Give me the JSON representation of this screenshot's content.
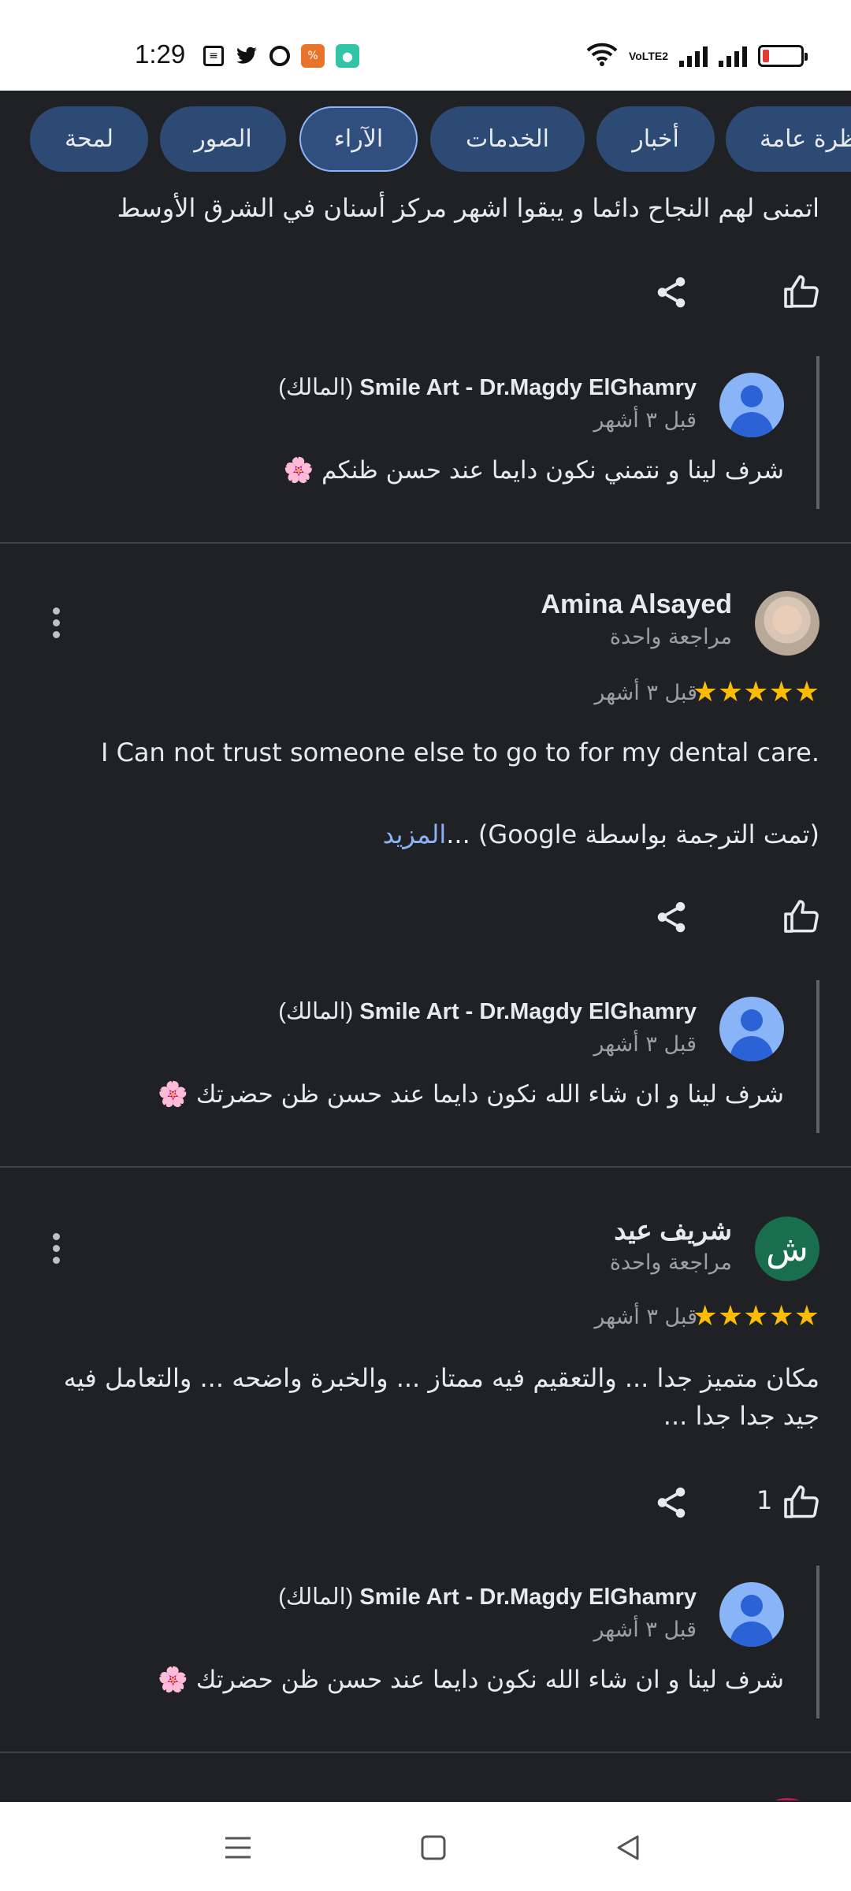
{
  "status_bar": {
    "time": "1:29",
    "left_icons": [
      "news-icon",
      "twitter-icon",
      "ring-icon",
      "offers-app-icon",
      "chat-app-icon"
    ],
    "volte_label": "VoLTE2",
    "battery_color": "#e53935"
  },
  "tabs": [
    {
      "label": "نظرة عامة",
      "active": false
    },
    {
      "label": "أخبار",
      "active": false
    },
    {
      "label": "الخدمات",
      "active": false
    },
    {
      "label": "الآراء",
      "active": true
    },
    {
      "label": "الصور",
      "active": false
    },
    {
      "label": "لمحة",
      "active": false
    }
  ],
  "top_partial": {
    "review_tail": "اتمنى لهم النجاح دائما و يبقوا اشهر مركز أسنان في الشرق الأوسط",
    "reply": {
      "owner_name": "Smile Art - Dr.Magdy ElGhamry",
      "owner_tag": "(المالك)",
      "time": "قبل ٣ أشهر",
      "text": "شرف لينا و نتمني نكون دايما عند حسن ظنكم 🌸"
    }
  },
  "reviews": [
    {
      "author": "Amina Alsayed",
      "author_sub": "مراجعة واحدة",
      "rating": 5,
      "time": "قبل ٣ أشهر",
      "text": "I Can not trust someone else to go to for my dental care.",
      "translation_note": "(تمت الترجمة بواسطة Google) ...",
      "more_label": "المزيد",
      "likes": "",
      "reply": {
        "owner_name": "Smile Art - Dr.Magdy ElGhamry",
        "owner_tag": "(المالك)",
        "time": "قبل ٣ أشهر",
        "text": "شرف لينا و ان شاء الله نكون دايما عند حسن ظن حضرتك 🌸"
      }
    },
    {
      "author": "شريف عيد",
      "author_initial": "ش",
      "author_sub": "مراجعة واحدة",
      "rating": 5,
      "time": "قبل ٣ أشهر",
      "text": "مكان متميز جدا ... والتعقيم فيه ممتاز ... والخبرة واضحه ... والتعامل فيه جيد جدا جدا ...",
      "likes": "1",
      "reply": {
        "owner_name": "Smile Art - Dr.Magdy ElGhamry",
        "owner_tag": "(المالك)",
        "time": "قبل ٣ أشهر",
        "text": "شرف لينا و ان شاء الله نكون دايما عند حسن ظن حضرتك 🌸"
      }
    }
  ],
  "stars_glyph": "★★★★★",
  "colors": {
    "background": "#202124",
    "chip": "#2d4a74",
    "chip_active_border": "#8ab4f8",
    "star": "#fbbc04",
    "link": "#8ab4f8"
  }
}
